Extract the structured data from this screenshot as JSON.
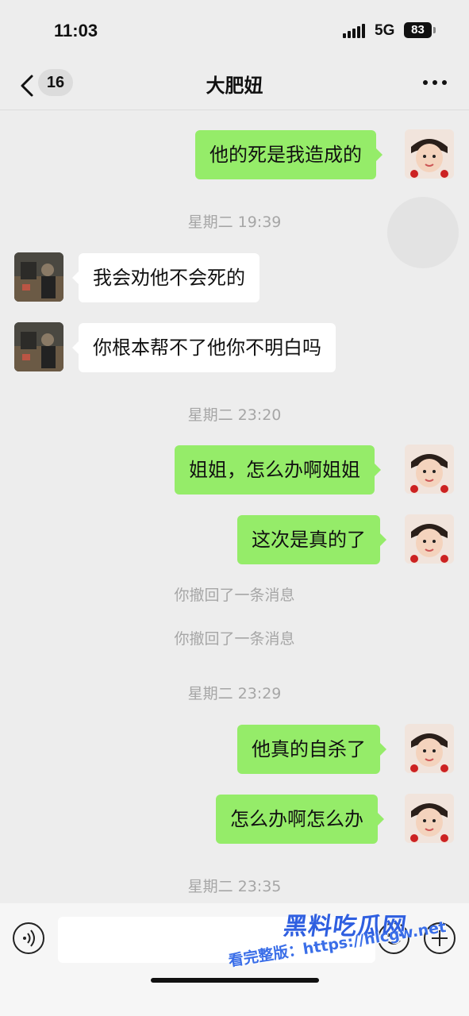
{
  "status_bar": {
    "time": "11:03",
    "network": "5G",
    "battery": "83"
  },
  "nav": {
    "unread_count": "16",
    "title": "大肥妞"
  },
  "messages": [
    {
      "text": "他的死是我造成的"
    },
    {
      "text": "星期二 19:39"
    },
    {
      "text": "我会劝他不会死的"
    },
    {
      "text": "你根本帮不了他你不明白吗"
    },
    {
      "text": "星期二 23:20"
    },
    {
      "text": "姐姐，怎么办啊姐姐"
    },
    {
      "text": "这次是真的了"
    },
    {
      "text": "你撤回了一条消息"
    },
    {
      "text": "你撤回了一条消息"
    },
    {
      "text": "星期二 23:29"
    },
    {
      "text": "他真的自杀了"
    },
    {
      "text": "怎么办啊怎么办"
    },
    {
      "text": "星期二 23:35"
    }
  ],
  "input_bar": {
    "value": ""
  },
  "watermark": {
    "line1": "黑料吃瓜网",
    "line2": "看完整版：https://hlcgw.net"
  },
  "colors": {
    "sent_bubble": "#95ec69",
    "recv_bubble": "#ffffff",
    "background": "#ededed"
  }
}
